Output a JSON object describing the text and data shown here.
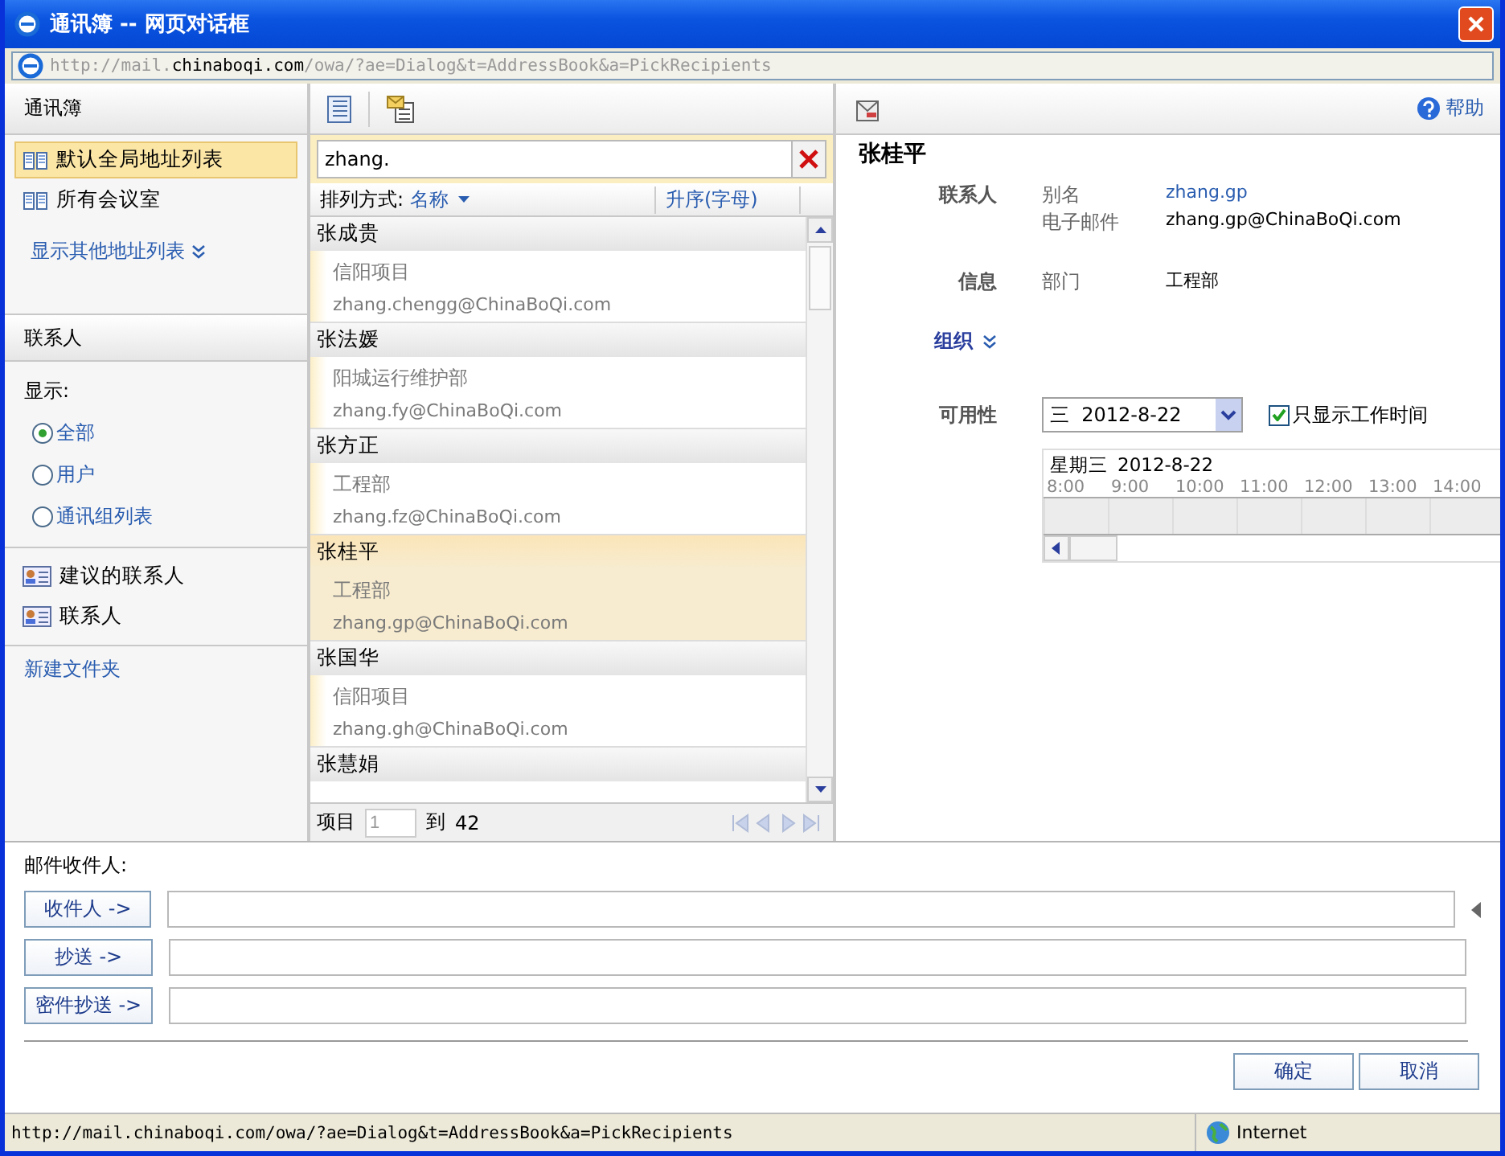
{
  "window": {
    "title": "通讯簿 -- 网页对话框"
  },
  "address_bar": {
    "url_parts": [
      {
        "text": "http://mail.",
        "strong": false
      },
      {
        "text": "chinaboqi.com",
        "strong": true
      },
      {
        "text": "/owa/?ae=Dialog&t=AddressBook&a=PickRecipients",
        "strong": false
      }
    ]
  },
  "sidebar": {
    "title": "通讯簿",
    "address_lists": [
      {
        "label": "默认全局地址列表",
        "selected": true
      },
      {
        "label": "所有会议室",
        "selected": false
      }
    ],
    "more_link": "显示其他地址列表",
    "contacts_header": "联系人",
    "show_label": "显示:",
    "filters": [
      {
        "label": "全部",
        "selected": true
      },
      {
        "label": "用户",
        "selected": false
      },
      {
        "label": "通讯组列表",
        "selected": false
      }
    ],
    "folders": [
      {
        "label": "建议的联系人",
        "selected": false
      },
      {
        "label": "联系人",
        "selected": false
      }
    ],
    "new_folder": "新建文件夹"
  },
  "list": {
    "search": {
      "value": "zhang."
    },
    "sort_label": "排列方式:",
    "sort_field": "名称",
    "order": "升序(字母)",
    "contacts": [
      {
        "name": "张成贵",
        "dept": "信阳项目",
        "email": "zhang.chengg@ChinaBoQi.com",
        "selected": false
      },
      {
        "name": "张法媛",
        "dept": "阳城运行维护部",
        "email": "zhang.fy@ChinaBoQi.com",
        "selected": false
      },
      {
        "name": "张方正",
        "dept": "工程部",
        "email": "zhang.fz@ChinaBoQi.com",
        "selected": false
      },
      {
        "name": "张桂平",
        "dept": "工程部",
        "email": "zhang.gp@ChinaBoQi.com",
        "selected": true
      },
      {
        "name": "张国华",
        "dept": "信阳项目",
        "email": "zhang.gh@ChinaBoQi.com",
        "selected": false
      },
      {
        "name": "张慧娟",
        "selected": false
      }
    ],
    "pager": {
      "label": "项目",
      "page": "1",
      "to": "到",
      "total": "42"
    }
  },
  "detail": {
    "help": "帮助",
    "name": "张桂平",
    "sections": [
      {
        "kind": "fields",
        "title": "联系人",
        "fields": [
          {
            "label": "别名",
            "value": "zhang.gp",
            "link": true
          },
          {
            "label": "电子邮件",
            "value": "zhang.gp@ChinaBoQi.com",
            "link": false
          }
        ]
      },
      {
        "kind": "fields",
        "title": "信息",
        "fields": [
          {
            "label": "部门",
            "value": "工程部",
            "link": false
          }
        ]
      },
      {
        "kind": "expander",
        "title": "组织"
      },
      {
        "kind": "availability",
        "title": "可用性",
        "date": "三  2012-8-22",
        "work_hours_only": {
          "label": "只显示工作时间",
          "checked": true
        },
        "day": "星期三",
        "day_date": "2012-8-22",
        "hours": [
          "8:00",
          "9:00",
          "10:00",
          "11:00",
          "12:00",
          "13:00",
          "14:00"
        ]
      }
    ]
  },
  "recipients": {
    "title": "邮件收件人:",
    "rows": [
      {
        "button": "收件人 ->"
      },
      {
        "button": "抄送 ->"
      },
      {
        "button": "密件抄送 ->"
      }
    ]
  },
  "buttons": [
    "确定",
    "取消"
  ],
  "status_bar": {
    "url": "http://mail.chinaboqi.com/owa/?ae=Dialog&t=AddressBook&a=PickRecipients",
    "zone": "Internet"
  }
}
